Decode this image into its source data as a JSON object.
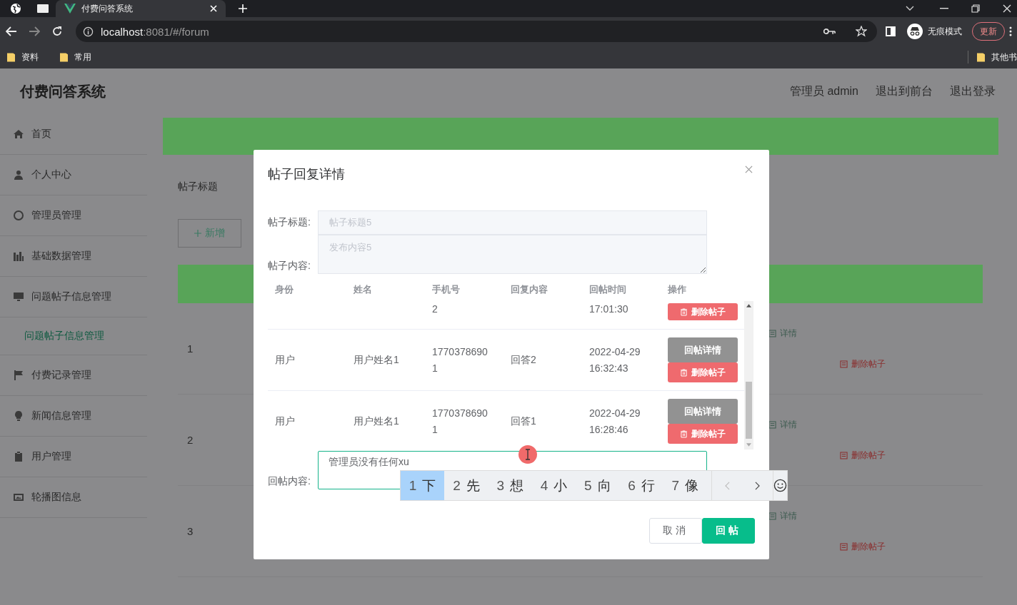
{
  "browser": {
    "tab_title": "付费问答系统",
    "url_host": "localhost",
    "url_rest": ":8081/#/forum",
    "incognito_label": "无痕模式",
    "update_button": "更新",
    "bookmarks": [
      {
        "label": "资料"
      },
      {
        "label": "常用"
      }
    ],
    "other_bookmarks": "其他书"
  },
  "app": {
    "title": "付费问答系统",
    "header_links": [
      "管理员 admin",
      "退出到前台",
      "退出登录"
    ]
  },
  "sidebar": {
    "items": [
      {
        "label": "首页"
      },
      {
        "label": "个人中心"
      },
      {
        "label": "管理员管理"
      },
      {
        "label": "基础数据管理"
      },
      {
        "label": "问题帖子信息管理",
        "children": [
          {
            "label": "问题帖子信息管理",
            "selected": true
          }
        ]
      },
      {
        "label": "付费记录管理"
      },
      {
        "label": "新闻信息管理"
      },
      {
        "label": "用户管理"
      },
      {
        "label": "轮播图信息"
      }
    ]
  },
  "main": {
    "search_label": "帖子标题",
    "add_button": "新增",
    "rows": [
      {
        "index": "1",
        "actions": [
          {
            "label": "详情",
            "kind": "detail"
          },
          {
            "label": "删除帖子",
            "kind": "delete"
          }
        ]
      },
      {
        "index": "2",
        "actions": [
          {
            "label": "详情",
            "kind": "detail"
          },
          {
            "label": "删除帖子",
            "kind": "delete"
          }
        ]
      },
      {
        "index": "3",
        "actions": [
          {
            "label": "详情",
            "kind": "detail"
          },
          {
            "label": "删除帖子",
            "kind": "delete"
          }
        ]
      }
    ]
  },
  "modal": {
    "title": "帖子回复详情",
    "fields": [
      {
        "label": "帖子标题:",
        "value": "帖子标题5",
        "kind": "input",
        "disabled": true
      },
      {
        "label": "帖子内容:",
        "value": "发布内容5",
        "kind": "textarea",
        "disabled": true
      }
    ],
    "table": {
      "columns": [
        "身份",
        "姓名",
        "手机号",
        "回复内容",
        "回帖时间",
        "操作"
      ],
      "rows": [
        {
          "kind": "partial",
          "phone": "2",
          "time": "17:01:30",
          "actions": [
            {
              "label": "删除帖子",
              "kind": "delete"
            }
          ]
        },
        {
          "kind": "full",
          "identity": "用户",
          "name": "用户姓名1",
          "phone": "17703786901",
          "content": "回答2",
          "time": "2022-04-29 16:32:43",
          "actions": [
            {
              "label": "回帖详情",
              "kind": "detail"
            },
            {
              "label": "删除帖子",
              "kind": "delete"
            }
          ]
        },
        {
          "kind": "full",
          "identity": "用户",
          "name": "用户姓名1",
          "phone": "17703786901",
          "content": "回答1",
          "time": "2022-04-29 16:28:46",
          "actions": [
            {
              "label": "回帖详情",
              "kind": "detail"
            },
            {
              "label": "删除帖子",
              "kind": "delete"
            }
          ]
        }
      ]
    },
    "reply": {
      "label": "回帖内容:",
      "value": "管理员没有任何xu"
    },
    "buttons": [
      {
        "label": "取消",
        "kind": "secondary"
      },
      {
        "label": "回帖",
        "kind": "primary"
      }
    ]
  },
  "ime": {
    "candidates": [
      {
        "number": "1",
        "text": "下",
        "selected": true
      },
      {
        "number": "2",
        "text": "先",
        "selected": false
      },
      {
        "number": "3",
        "text": "想",
        "selected": false
      },
      {
        "number": "4",
        "text": "小",
        "selected": false
      },
      {
        "number": "5",
        "text": "向",
        "selected": false
      },
      {
        "number": "6",
        "text": "行",
        "selected": false
      },
      {
        "number": "7",
        "text": "像",
        "selected": false
      }
    ]
  }
}
